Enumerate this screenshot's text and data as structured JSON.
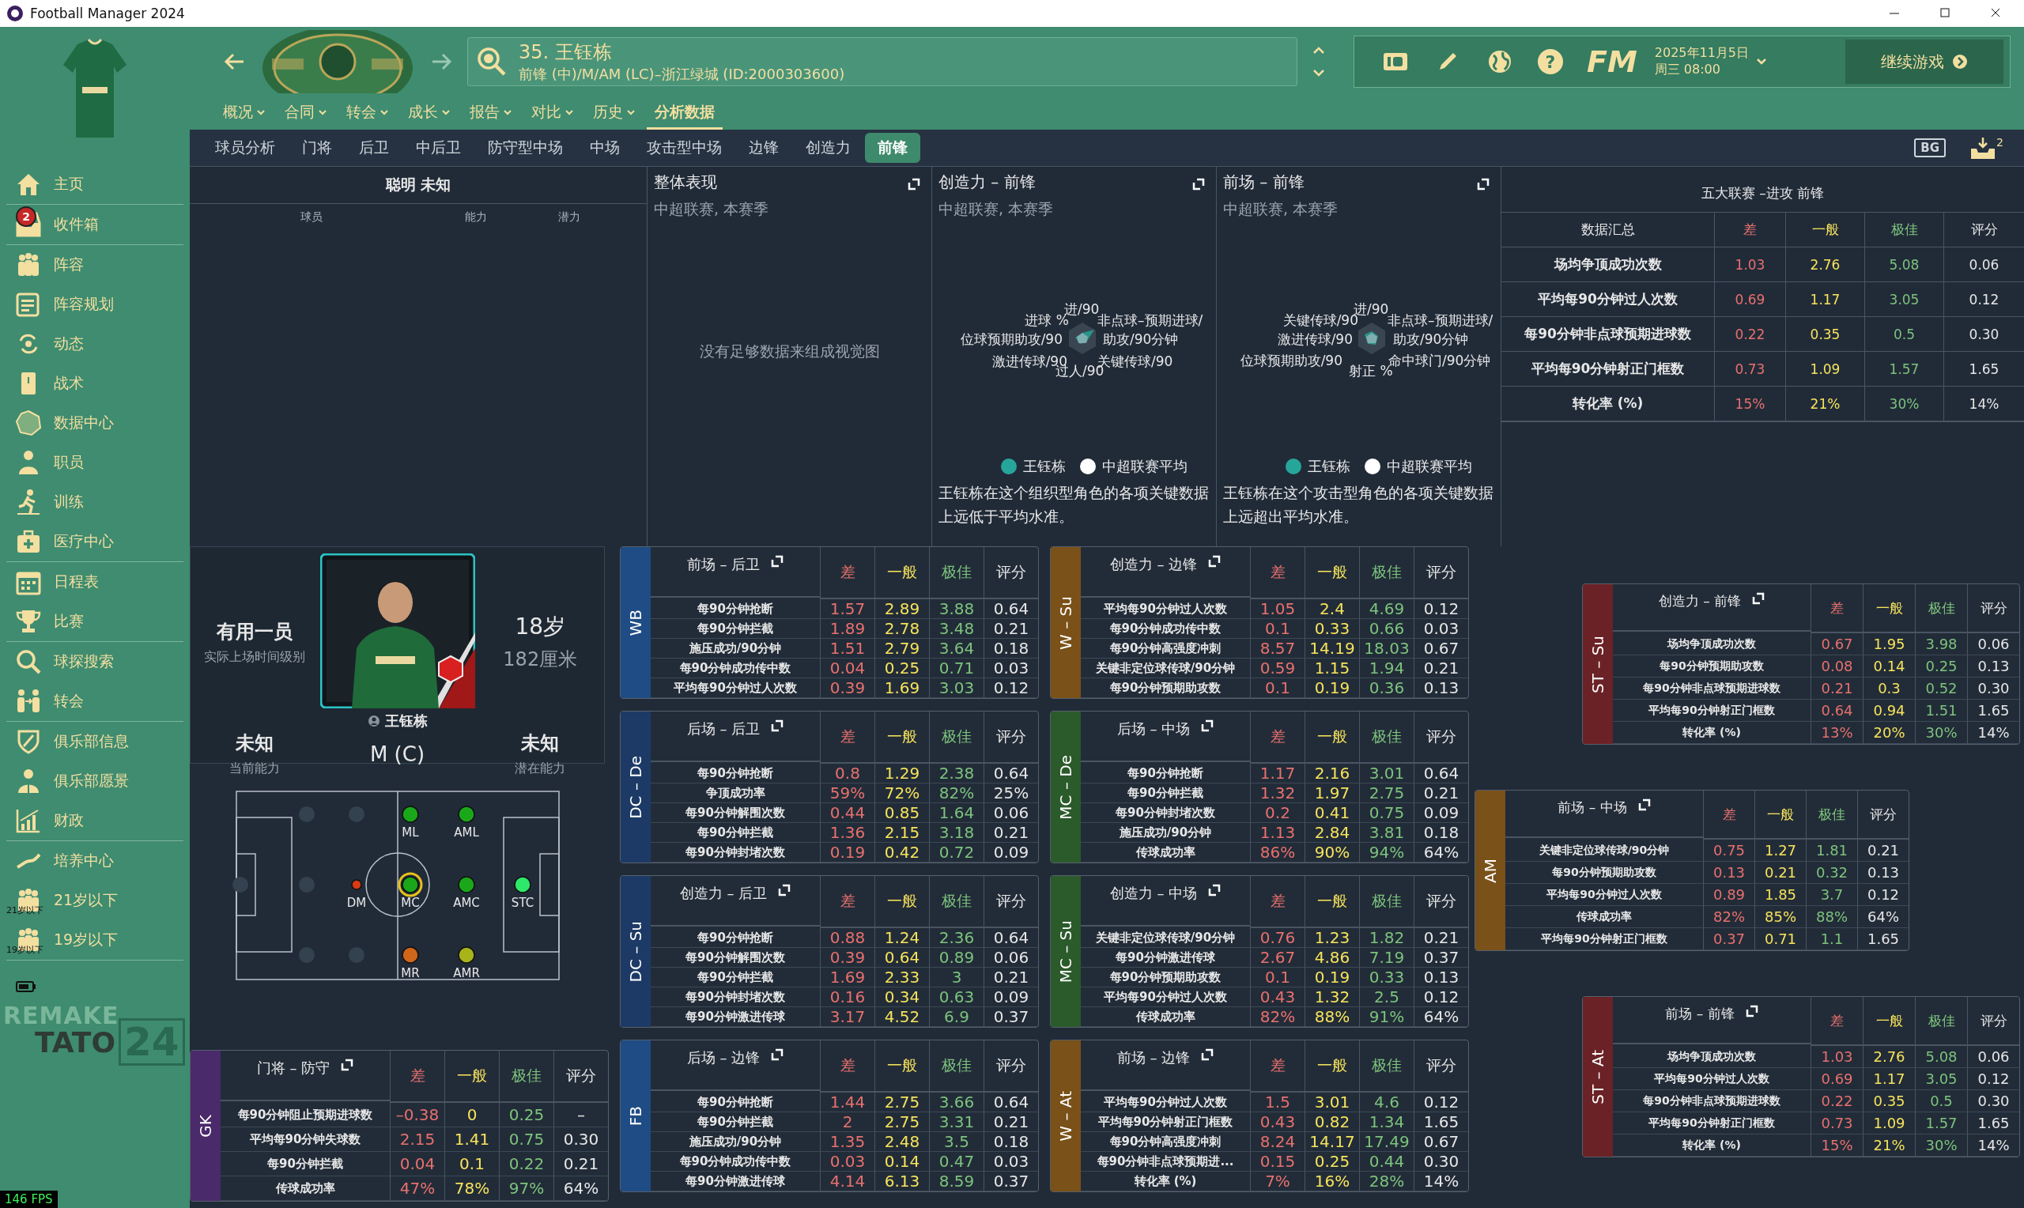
{
  "window": {
    "title": "Football Manager 2024"
  },
  "sidebar": {
    "groups": [
      [
        {
          "label": "主页"
        }
      ],
      [
        {
          "label": "收件箱",
          "badge": "2"
        }
      ],
      [
        {
          "label": "阵容"
        },
        {
          "label": "阵容规划"
        },
        {
          "label": "动态"
        },
        {
          "label": "战术"
        },
        {
          "label": "数据中心"
        },
        {
          "label": "职员"
        },
        {
          "label": "训练"
        },
        {
          "label": "医疗中心"
        }
      ],
      [
        {
          "label": "日程表"
        },
        {
          "label": "比赛"
        }
      ],
      [
        {
          "label": "球探搜索"
        },
        {
          "label": "转会"
        }
      ],
      [
        {
          "label": "俱乐部信息"
        },
        {
          "label": "俱乐部愿景"
        },
        {
          "label": "财政"
        }
      ],
      [
        {
          "label": "培养中心"
        },
        {
          "label": "21岁以下",
          "icon_label": "21岁以下"
        },
        {
          "label": "19岁以下",
          "icon_label": "19岁以下"
        }
      ]
    ],
    "logo_top": "REMAKE",
    "logo_word": "TATO",
    "logo_number": "24",
    "fps": "146 FPS"
  },
  "header": {
    "player_title": "35. 王钰栋",
    "player_subtitle": "前锋 (中)/M/AM (LC)–浙江绿城 (ID:2000303600)",
    "help_label": "?",
    "fm_logo": "FM",
    "date": "2025年11月5日",
    "time": "周三 08:00",
    "continue_button": "继续游戏",
    "bg_label": "BG",
    "inbox_count": "2",
    "menu": [
      {
        "label": "概况",
        "has_dropdown": true,
        "selected": false
      },
      {
        "label": "合同",
        "has_dropdown": true,
        "selected": false
      },
      {
        "label": "转会",
        "has_dropdown": true,
        "selected": false
      },
      {
        "label": "成长",
        "has_dropdown": true,
        "selected": false
      },
      {
        "label": "报告",
        "has_dropdown": true,
        "selected": false
      },
      {
        "label": "对比",
        "has_dropdown": true,
        "selected": false
      },
      {
        "label": "历史",
        "has_dropdown": true,
        "selected": false
      },
      {
        "label": "分析数据",
        "has_dropdown": false,
        "selected": true
      }
    ],
    "tabs": [
      {
        "label": "球员分析",
        "selected": false
      },
      {
        "label": "门将",
        "selected": false
      },
      {
        "label": "后卫",
        "selected": false
      },
      {
        "label": "中后卫",
        "selected": false
      },
      {
        "label": "防守型中场",
        "selected": false
      },
      {
        "label": "中场",
        "selected": false
      },
      {
        "label": "攻击型中场",
        "selected": false
      },
      {
        "label": "边锋",
        "selected": false
      },
      {
        "label": "创造力",
        "selected": false
      },
      {
        "label": "前锋",
        "selected": true
      }
    ]
  },
  "players_panel": {
    "title": "聪明 未知",
    "columns": [
      "球员",
      "能力",
      "潜力"
    ]
  },
  "overview_panel": {
    "title": "整体表现",
    "subtitle": "中超联赛, 本赛季",
    "message": "没有足够数据来组成视觉图"
  },
  "radar_panels": [
    {
      "title": "创造力 – 前锋",
      "subtitle": "中超联赛, 本赛季",
      "axes": [
        "进/90",
        "进球 %",
        "非点球–预期进球/",
        "位球预期助攻/90",
        "助攻/90分钟",
        "激进传球/90",
        "关键传球/90",
        "过人/90"
      ],
      "legend": [
        {
          "label": "王钰栋",
          "color": "#26a69a"
        },
        {
          "label": "中超联赛平均",
          "color": "#ffffff"
        }
      ],
      "description": "王钰栋在这个组织型角色的各项关键数据上远低于平均水准。"
    },
    {
      "title": "前场 – 前锋",
      "subtitle": "中超联赛, 本赛季",
      "axes": [
        "进/90",
        "关键传球/90",
        "非点球–预期进球/",
        "激进传球/90",
        "助攻/90分钟",
        "位球预期助攻/90",
        "命中球门/90分钟",
        "射正 %"
      ],
      "legend": [
        {
          "label": "王钰栋",
          "color": "#26a69a"
        },
        {
          "label": "中超联赛平均",
          "color": "#ffffff"
        }
      ],
      "description": "王钰栋在这个攻击型角色的各项关键数据上远超出平均水准。"
    }
  ],
  "summary_table": {
    "title": "五大联赛 –进攻 前锋",
    "columns": [
      "数据汇总",
      "差",
      "一般",
      "极佳",
      "评分"
    ],
    "rows": [
      [
        "场均争顶成功次数",
        "1.03",
        "2.76",
        "5.08",
        "0.06"
      ],
      [
        "平均每90分钟过人次数",
        "0.69",
        "1.17",
        "3.05",
        "0.12"
      ],
      [
        "每90分钟非点球预期进球数",
        "0.22",
        "0.35",
        "0.5",
        "0.30"
      ],
      [
        "平均每90分钟射正门框数",
        "0.73",
        "1.09",
        "1.57",
        "1.65"
      ],
      [
        "转化率 (%)",
        "15%",
        "21%",
        "30%",
        "14%"
      ]
    ]
  },
  "player_card": {
    "role_level": "有用一员",
    "role_caption": "实际上场时间级别",
    "name": "王钰栋",
    "age": "18岁",
    "height": "182厘米",
    "current_ability": "未知",
    "current_caption": "当前能力",
    "position": "M (C)",
    "potential": "未知",
    "potential_caption": "潜在能力"
  },
  "pitch": {
    "positions": [
      {
        "label": "ML",
        "color": "#1aa81a",
        "selected": false
      },
      {
        "label": "AML",
        "color": "#1aa81a",
        "selected": false
      },
      {
        "label": "DM",
        "color": "#d83a12",
        "selected": false
      },
      {
        "label": "MC",
        "color": "#1aa81a",
        "selected": true
      },
      {
        "label": "AMC",
        "color": "#1aa81a",
        "selected": false
      },
      {
        "label": "STC",
        "color": "#2ee86a",
        "selected": false
      },
      {
        "label": "MR",
        "color": "#d0661a",
        "selected": false
      },
      {
        "label": "AMR",
        "color": "#a8b41a",
        "selected": false
      }
    ]
  },
  "gk_table": {
    "role": "GK",
    "color": "#4a2a6a",
    "columns": [
      "门将 – 防守",
      "差",
      "一般",
      "极佳",
      "评分"
    ],
    "rows": [
      [
        "每90分钟阻止预期进球数",
        "–0.38",
        "0",
        "0.25",
        "–"
      ],
      [
        "平均每90分钟失球数",
        "2.15",
        "1.41",
        "0.75",
        "0.30"
      ],
      [
        "每90分钟拦截",
        "0.04",
        "0.1",
        "0.22",
        "0.21"
      ],
      [
        "传球成功率",
        "47%",
        "78%",
        "97%",
        "64%"
      ]
    ]
  },
  "tables_col1": [
    {
      "role": "WB",
      "color": "#1f4c85",
      "columns": [
        "前场 – 后卫",
        "差",
        "一般",
        "极佳",
        "评分"
      ],
      "rows": [
        [
          "每90分钟抢断",
          "1.57",
          "2.89",
          "3.88",
          "0.64"
        ],
        [
          "每90分钟拦截",
          "1.89",
          "2.78",
          "3.48",
          "0.21"
        ],
        [
          "施压成功/90分钟",
          "1.51",
          "2.79",
          "3.64",
          "0.18"
        ],
        [
          "每90分钟成功传中数",
          "0.04",
          "0.25",
          "0.71",
          "0.03"
        ],
        [
          "平均每90分钟过人次数",
          "0.39",
          "1.69",
          "3.03",
          "0.12"
        ]
      ]
    },
    {
      "role": "DC – De",
      "color": "#1d3a66",
      "columns": [
        "后场 – 后卫",
        "差",
        "一般",
        "极佳",
        "评分"
      ],
      "rows": [
        [
          "每90分钟抢断",
          "0.8",
          "1.29",
          "2.38",
          "0.64"
        ],
        [
          "争顶成功率",
          "59%",
          "72%",
          "82%",
          "25%"
        ],
        [
          "每90分钟解围次数",
          "0.44",
          "0.85",
          "1.64",
          "0.06"
        ],
        [
          "每90分钟拦截",
          "1.36",
          "2.15",
          "3.18",
          "0.21"
        ],
        [
          "每90分钟封堵次数",
          "0.19",
          "0.42",
          "0.72",
          "0.09"
        ]
      ]
    },
    {
      "role": "DC – Su",
      "color": "#1d3a66",
      "columns": [
        "创造力 – 后卫",
        "差",
        "一般",
        "极佳",
        "评分"
      ],
      "rows": [
        [
          "每90分钟抢断",
          "0.88",
          "1.24",
          "2.36",
          "0.64"
        ],
        [
          "每90分钟解围次数",
          "0.39",
          "0.64",
          "0.89",
          "0.06"
        ],
        [
          "每90分钟拦截",
          "1.69",
          "2.33",
          "3",
          "0.21"
        ],
        [
          "每90分钟封堵次数",
          "0.16",
          "0.34",
          "0.63",
          "0.09"
        ],
        [
          "每90分钟激进传球",
          "3.17",
          "4.52",
          "6.9",
          "0.37"
        ]
      ]
    },
    {
      "role": "FB",
      "color": "#1f4c85",
      "columns": [
        "后场 – 边锋",
        "差",
        "一般",
        "极佳",
        "评分"
      ],
      "rows": [
        [
          "每90分钟抢断",
          "1.44",
          "2.75",
          "3.66",
          "0.64"
        ],
        [
          "每90分钟拦截",
          "2",
          "2.75",
          "3.31",
          "0.21"
        ],
        [
          "施压成功/90分钟",
          "1.35",
          "2.48",
          "3.5",
          "0.18"
        ],
        [
          "每90分钟成功传中数",
          "0.03",
          "0.14",
          "0.47",
          "0.03"
        ],
        [
          "每90分钟激进传球",
          "4.14",
          "6.13",
          "8.59",
          "0.37"
        ]
      ]
    }
  ],
  "tables_col2": [
    {
      "role": "W – Su",
      "color": "#7a5118",
      "columns": [
        "创造力 – 边锋",
        "差",
        "一般",
        "极佳",
        "评分"
      ],
      "rows": [
        [
          "平均每90分钟过人次数",
          "1.05",
          "2.4",
          "4.69",
          "0.12"
        ],
        [
          "每90分钟成功传中数",
          "0.1",
          "0.33",
          "0.66",
          "0.03"
        ],
        [
          "每90分钟高强度冲刺",
          "8.57",
          "14.19",
          "18.03",
          "0.67"
        ],
        [
          "关键非定位球传球/90分钟",
          "0.59",
          "1.15",
          "1.94",
          "0.21"
        ],
        [
          "每90分钟预期助攻数",
          "0.1",
          "0.19",
          "0.36",
          "0.13"
        ]
      ]
    },
    {
      "role": "MC – De",
      "color": "#2b5a2b",
      "columns": [
        "后场 – 中场",
        "差",
        "一般",
        "极佳",
        "评分"
      ],
      "rows": [
        [
          "每90分钟抢断",
          "1.17",
          "2.16",
          "3.01",
          "0.64"
        ],
        [
          "每90分钟拦截",
          "1.32",
          "1.97",
          "2.75",
          "0.21"
        ],
        [
          "每90分钟封堵次数",
          "0.2",
          "0.41",
          "0.75",
          "0.09"
        ],
        [
          "施压成功/90分钟",
          "1.13",
          "2.84",
          "3.81",
          "0.18"
        ],
        [
          "传球成功率",
          "86%",
          "90%",
          "94%",
          "64%"
        ]
      ]
    },
    {
      "role": "MC – Su",
      "color": "#2b5a2b",
      "columns": [
        "创造力 – 中场",
        "差",
        "一般",
        "极佳",
        "评分"
      ],
      "rows": [
        [
          "关键非定位球传球/90分钟",
          "0.76",
          "1.23",
          "1.82",
          "0.21"
        ],
        [
          "每90分钟激进传球",
          "2.67",
          "4.86",
          "7.19",
          "0.37"
        ],
        [
          "每90分钟预期助攻数",
          "0.1",
          "0.19",
          "0.33",
          "0.13"
        ],
        [
          "平均每90分钟过人次数",
          "0.43",
          "1.32",
          "2.5",
          "0.12"
        ],
        [
          "传球成功率",
          "82%",
          "88%",
          "91%",
          "64%"
        ]
      ]
    },
    {
      "role": "W – At",
      "color": "#7a5118",
      "columns": [
        "前场 – 边锋",
        "差",
        "一般",
        "极佳",
        "评分"
      ],
      "rows": [
        [
          "平均每90分钟过人次数",
          "1.5",
          "3.01",
          "4.6",
          "0.12"
        ],
        [
          "平均每90分钟射正门框数",
          "0.43",
          "0.82",
          "1.34",
          "1.65"
        ],
        [
          "每90分钟高强度冲刺",
          "8.24",
          "14.17",
          "17.49",
          "0.67"
        ],
        [
          "每90分钟非点球预期进...",
          "0.15",
          "0.25",
          "0.44",
          "0.30"
        ],
        [
          "转化率 (%)",
          "7%",
          "16%",
          "28%",
          "14%"
        ]
      ]
    }
  ],
  "tables_right": [
    {
      "role": "ST – Su",
      "color": "#6b2226",
      "columns": [
        "创造力 – 前锋",
        "差",
        "一般",
        "极佳",
        "评分"
      ],
      "rows": [
        [
          "场均争顶成功次数",
          "0.67",
          "1.95",
          "3.98",
          "0.06"
        ],
        [
          "每90分钟预期助攻数",
          "0.08",
          "0.14",
          "0.25",
          "0.13"
        ],
        [
          "每90分钟非点球预期进球数",
          "0.21",
          "0.3",
          "0.52",
          "0.30"
        ],
        [
          "平均每90分钟射正门框数",
          "0.64",
          "0.94",
          "1.51",
          "1.65"
        ],
        [
          "转化率 (%)",
          "13%",
          "20%",
          "30%",
          "14%"
        ]
      ]
    },
    {
      "role": "AM",
      "color": "#7a5118",
      "columns": [
        "前场 – 中场",
        "差",
        "一般",
        "极佳",
        "评分"
      ],
      "rows": [
        [
          "关键非定位球传球/90分钟",
          "0.75",
          "1.27",
          "1.81",
          "0.21"
        ],
        [
          "每90分钟预期助攻数",
          "0.13",
          "0.21",
          "0.32",
          "0.13"
        ],
        [
          "平均每90分钟过人次数",
          "0.89",
          "1.85",
          "3.7",
          "0.12"
        ],
        [
          "传球成功率",
          "82%",
          "85%",
          "88%",
          "64%"
        ],
        [
          "平均每90分钟射正门框数",
          "0.37",
          "0.71",
          "1.1",
          "1.65"
        ]
      ]
    },
    {
      "role": "ST – At",
      "color": "#6b2226",
      "columns": [
        "前场 – 前锋",
        "差",
        "一般",
        "极佳",
        "评分"
      ],
      "rows": [
        [
          "场均争顶成功次数",
          "1.03",
          "2.76",
          "5.08",
          "0.06"
        ],
        [
          "平均每90分钟过人次数",
          "0.69",
          "1.17",
          "3.05",
          "0.12"
        ],
        [
          "每90分钟非点球预期进球数",
          "0.22",
          "0.35",
          "0.5",
          "0.30"
        ],
        [
          "平均每90分钟射正门框数",
          "0.73",
          "1.09",
          "1.57",
          "1.65"
        ],
        [
          "转化率 (%)",
          "15%",
          "21%",
          "30%",
          "14%"
        ]
      ]
    }
  ]
}
